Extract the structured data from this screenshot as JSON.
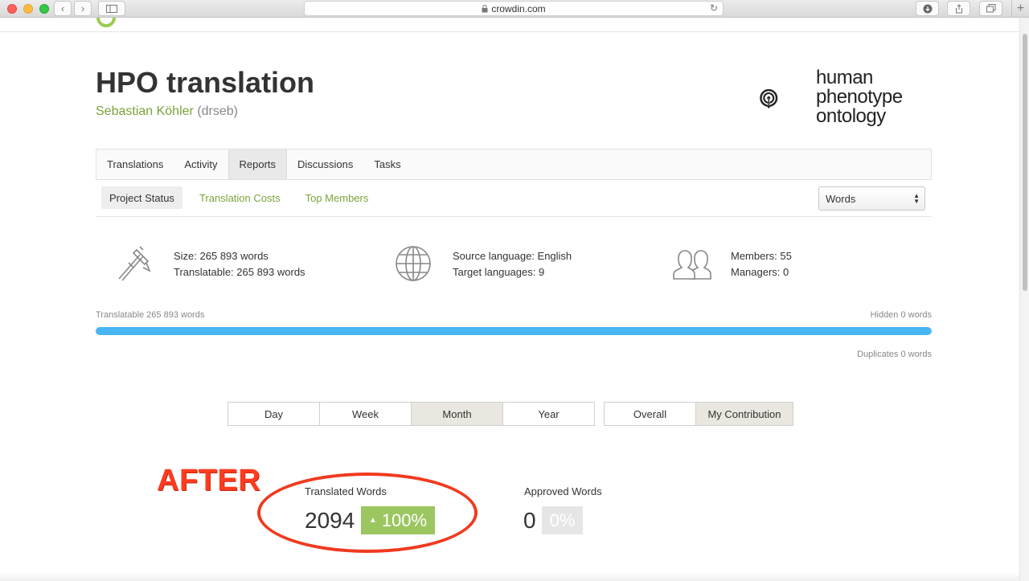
{
  "browser": {
    "url": "crowdin.com"
  },
  "project": {
    "title": "HPO translation",
    "owner_name": "Sebastian Köhler",
    "owner_handle": "(drseb)"
  },
  "brand": {
    "line1": "human",
    "line2": "phenotype",
    "line3": "ontology"
  },
  "tabs": [
    {
      "label": "Translations"
    },
    {
      "label": "Activity"
    },
    {
      "label": "Reports",
      "active": true
    },
    {
      "label": "Discussions"
    },
    {
      "label": "Tasks"
    }
  ],
  "subtabs": [
    {
      "label": "Project Status",
      "active": true
    },
    {
      "label": "Translation Costs"
    },
    {
      "label": "Top Members"
    }
  ],
  "unit_select": {
    "value": "Words"
  },
  "stats": {
    "size": "Size: 265 893 words",
    "translatable": "Translatable: 265 893 words",
    "source_language": "Source language: English",
    "target_languages": "Target languages: 9",
    "members": "Members: 55",
    "managers": "Managers: 0"
  },
  "progress": {
    "left_label": "Translatable 265 893 words",
    "right_label": "Hidden 0 words",
    "fill_percent": 100,
    "duplicates_label": "Duplicates 0 words",
    "color": "#48b6f5"
  },
  "period_buttons": [
    {
      "label": "Day"
    },
    {
      "label": "Week"
    },
    {
      "label": "Month",
      "active": true
    },
    {
      "label": "Year"
    }
  ],
  "scope_buttons": [
    {
      "label": "Overall"
    },
    {
      "label": "My Contribution",
      "active": true
    }
  ],
  "annotation": {
    "text": "AFTER",
    "color": "#ff3b1f"
  },
  "metrics": {
    "translated_label": "Translated Words",
    "translated_value": "2094",
    "translated_percent": "100%",
    "translated_arrow": "▲",
    "approved_label": "Approved Words",
    "approved_value": "0",
    "approved_percent": "0%"
  }
}
